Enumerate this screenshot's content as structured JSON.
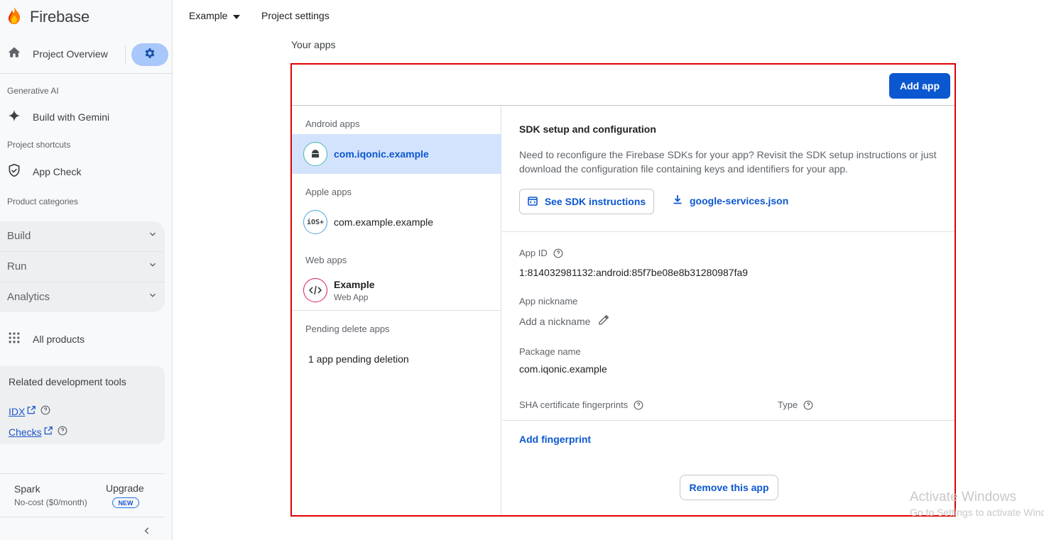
{
  "brand": "Firebase",
  "sidebar": {
    "project_overview": "Project Overview",
    "section_genai": "Generative AI",
    "build_with_gemini": "Build with Gemini",
    "section_shortcuts": "Project shortcuts",
    "app_check": "App Check",
    "section_categories": "Product categories",
    "groups": [
      "Build",
      "Run",
      "Analytics"
    ],
    "all_products": "All products",
    "related_title": "Related development tools",
    "idx": "IDX",
    "checks": "Checks",
    "plan_name": "Spark",
    "plan_sub": "No-cost ($0/month)",
    "upgrade": "Upgrade",
    "new_badge": "NEW"
  },
  "header": {
    "project": "Example",
    "settings": "Project settings"
  },
  "main": {
    "your_apps": "Your apps",
    "add_app": "Add app",
    "android_head": "Android apps",
    "android_app": "com.iqonic.example",
    "apple_head": "Apple apps",
    "apple_app": "com.example.example",
    "ios_badge": "iOS+",
    "web_head": "Web apps",
    "web_app": "Example",
    "web_sub": "Web App",
    "pending_head": "Pending delete apps",
    "pending_text": "1 app pending deletion",
    "sdk_title": "SDK setup and configuration",
    "sdk_desc": "Need to reconfigure the Firebase SDKs for your app? Revisit the SDK setup instructions or just download the configuration file containing keys and identifiers for your app.",
    "sdk_button": "See SDK instructions",
    "json_link": "google-services.json",
    "app_id_label": "App ID",
    "app_id_value": "1:814032981132:android:85f7be08e8b31280987fa9",
    "nickname_label": "App nickname",
    "nickname_placeholder": "Add a nickname",
    "package_label": "Package name",
    "package_value": "com.iqonic.example",
    "sha_label": "SHA certificate fingerprints",
    "type_label": "Type",
    "add_fingerprint": "Add fingerprint",
    "remove_app": "Remove this app"
  },
  "watermark": {
    "line1": "Activate Windows",
    "line2": "Go to Settings to activate Windows."
  },
  "colors": {
    "primary": "#0b57d0",
    "selected_bg": "#d3e3fd",
    "highlight_border": "#e00000",
    "settings_pill": "#a8c7fa"
  }
}
